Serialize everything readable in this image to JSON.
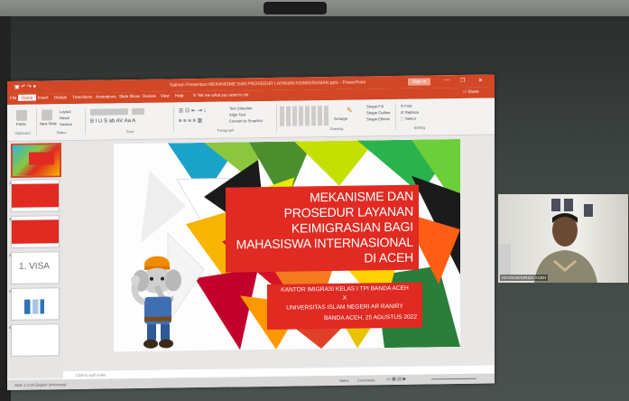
{
  "window": {
    "title": "Salinan Presentasi MEKANISME DAN PROSEDUR LAYANAN KEIMIGRASIAN.pptx - PowerPoint",
    "signin": "Sign in",
    "controls": [
      "—",
      "❐",
      "✕"
    ]
  },
  "ribbon": {
    "tabs": [
      "File",
      "Home",
      "Insert",
      "Design",
      "Transitions",
      "Animations",
      "Slide Show",
      "Review",
      "View",
      "Help"
    ],
    "active_tab": "Home",
    "tell_me": "Tell me what you want to do",
    "share": "Share",
    "clipboard": {
      "paste": "Paste",
      "label": "Clipboard"
    },
    "slides": {
      "new_slide": "New Slide",
      "layout": "Layout",
      "reset": "Reset",
      "section": "Section",
      "label": "Slides"
    },
    "font": {
      "label": "Font"
    },
    "paragraph": {
      "text_direction": "Text Direction",
      "align_text": "Align Text",
      "convert": "Convert to SmartArt",
      "label": "Paragraph"
    },
    "drawing": {
      "arrange": "Arrange",
      "quick_styles": "Quick Styles",
      "shape_fill": "Shape Fill",
      "shape_outline": "Shape Outline",
      "shape_effects": "Shape Effects",
      "label": "Drawing"
    },
    "editing": {
      "find": "Find",
      "replace": "Replace",
      "select": "Select",
      "label": "Editing"
    }
  },
  "thumbnails": [
    {
      "num": "1"
    },
    {
      "num": "2"
    },
    {
      "num": "3"
    },
    {
      "num": "4",
      "text": "1. VISA"
    },
    {
      "num": "5"
    },
    {
      "num": "6"
    }
  ],
  "slide": {
    "title_lines": [
      "MEKANISME DAN",
      "PROSEDUR LAYANAN",
      "KEIMIGRASIAN BAGI",
      "MAHASISWA INTERNASIONAL",
      "DI ACEH"
    ],
    "subtitle_lines": [
      "KANTOR IMIGRASI KELAS I TPI BANDA ACEH",
      "X",
      "UNIVERSITAS ISLAM NEGERI AR RANIRY",
      "BANDA ACEH, 25 AGUSTUS 2022"
    ]
  },
  "notes": {
    "placeholder": "Click to add notes"
  },
  "status": {
    "left": "Slide 1 of 29   English (Indonesia)",
    "notes": "Notes",
    "comments": "Comments"
  },
  "participant": {
    "name": "KEVIN MAHRIZA ACEH"
  },
  "colors": {
    "ppt_accent": "#d24726",
    "title_red": "#e02a22"
  }
}
